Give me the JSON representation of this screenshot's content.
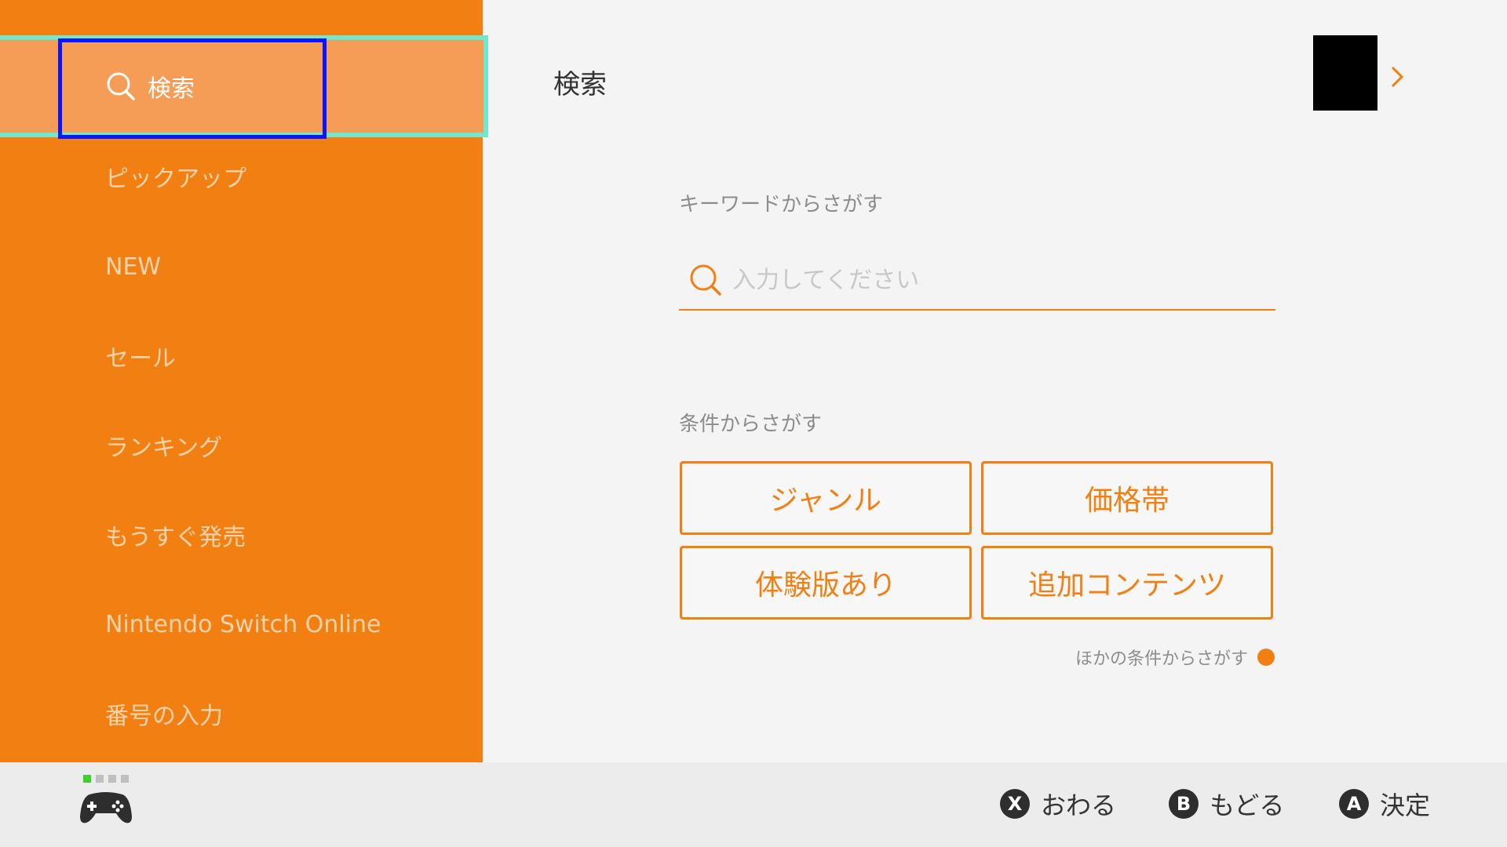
{
  "sidebar": {
    "items": [
      {
        "label": "検索",
        "icon": "search-icon",
        "selected": true
      },
      {
        "label": "ピックアップ"
      },
      {
        "label": "NEW"
      },
      {
        "label": "セール"
      },
      {
        "label": "ランキング"
      },
      {
        "label": "もうすぐ発売"
      },
      {
        "label": "Nintendo Switch Online"
      },
      {
        "label": "番号の入力"
      }
    ]
  },
  "main": {
    "title": "検索",
    "keyword_section": {
      "label": "キーワードからさがす",
      "search_placeholder": "入力してください"
    },
    "condition_section": {
      "label": "条件からさがす",
      "buttons": [
        "ジャンル",
        "価格帯",
        "体験版あり",
        "追加コンテンツ"
      ],
      "more_link": "ほかの条件からさがす"
    }
  },
  "footer": {
    "player_indicator": "controller-icon",
    "hints": [
      {
        "key": "X",
        "label": "おわる"
      },
      {
        "key": "B",
        "label": "もどる"
      },
      {
        "key": "A",
        "label": "決定"
      }
    ]
  },
  "colors": {
    "accent": "#f27f12",
    "selected_bg": "#f59c56",
    "focus_outline": "#6fe8cf",
    "cursor": "#0a15ff"
  }
}
